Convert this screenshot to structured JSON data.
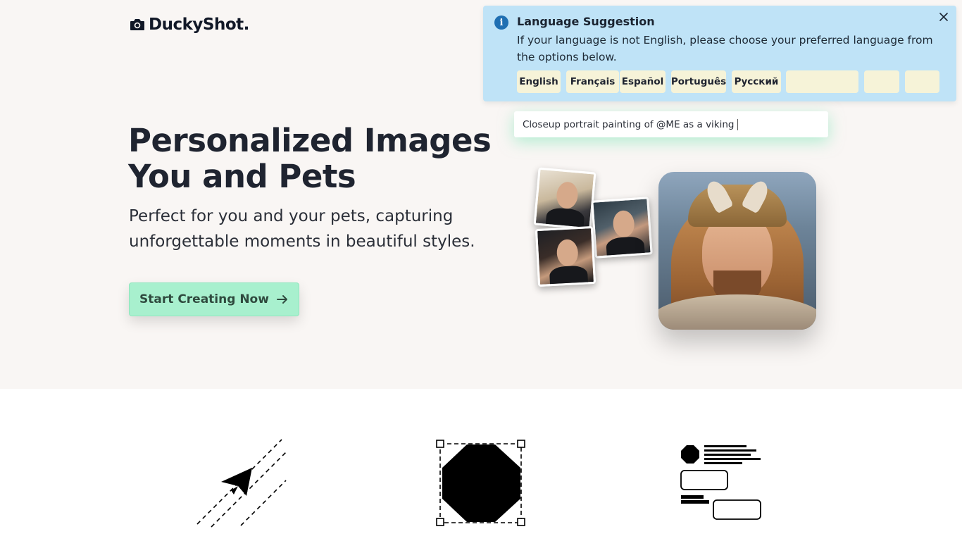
{
  "brand": {
    "name": "DuckyShot.",
    "icon": "camera-icon"
  },
  "hero": {
    "headline_line1": "Personalized Images",
    "headline_line2": "You and Pets",
    "subtext_line1": "Perfect for you and your pets, capturing",
    "subtext_line2": "unforgettable moments in beautiful styles.",
    "cta_label": "Start Creating Now",
    "cta_icon": "arrow-right-icon"
  },
  "prompt": {
    "text": "Closeup portrait painting of @ME as a viking"
  },
  "language_banner": {
    "icon": "info-icon",
    "title": "Language Suggestion",
    "message": "If your language is not English, please choose your preferred language from the options below.",
    "close_icon": "close-icon",
    "languages": [
      "English",
      "Français",
      "Español",
      "Português",
      "Русский",
      "",
      "",
      ""
    ]
  },
  "features": {
    "icons": [
      "paper-plane-icon",
      "octagon-selection-icon",
      "text-layout-icon"
    ]
  },
  "colors": {
    "hero_bg": "#f9f6f4",
    "cta_bg": "#a8f0ce",
    "banner_bg": "#bfe3f7",
    "lang_btn_bg": "#f6f3d8",
    "info_blue": "#1f6fb2"
  }
}
